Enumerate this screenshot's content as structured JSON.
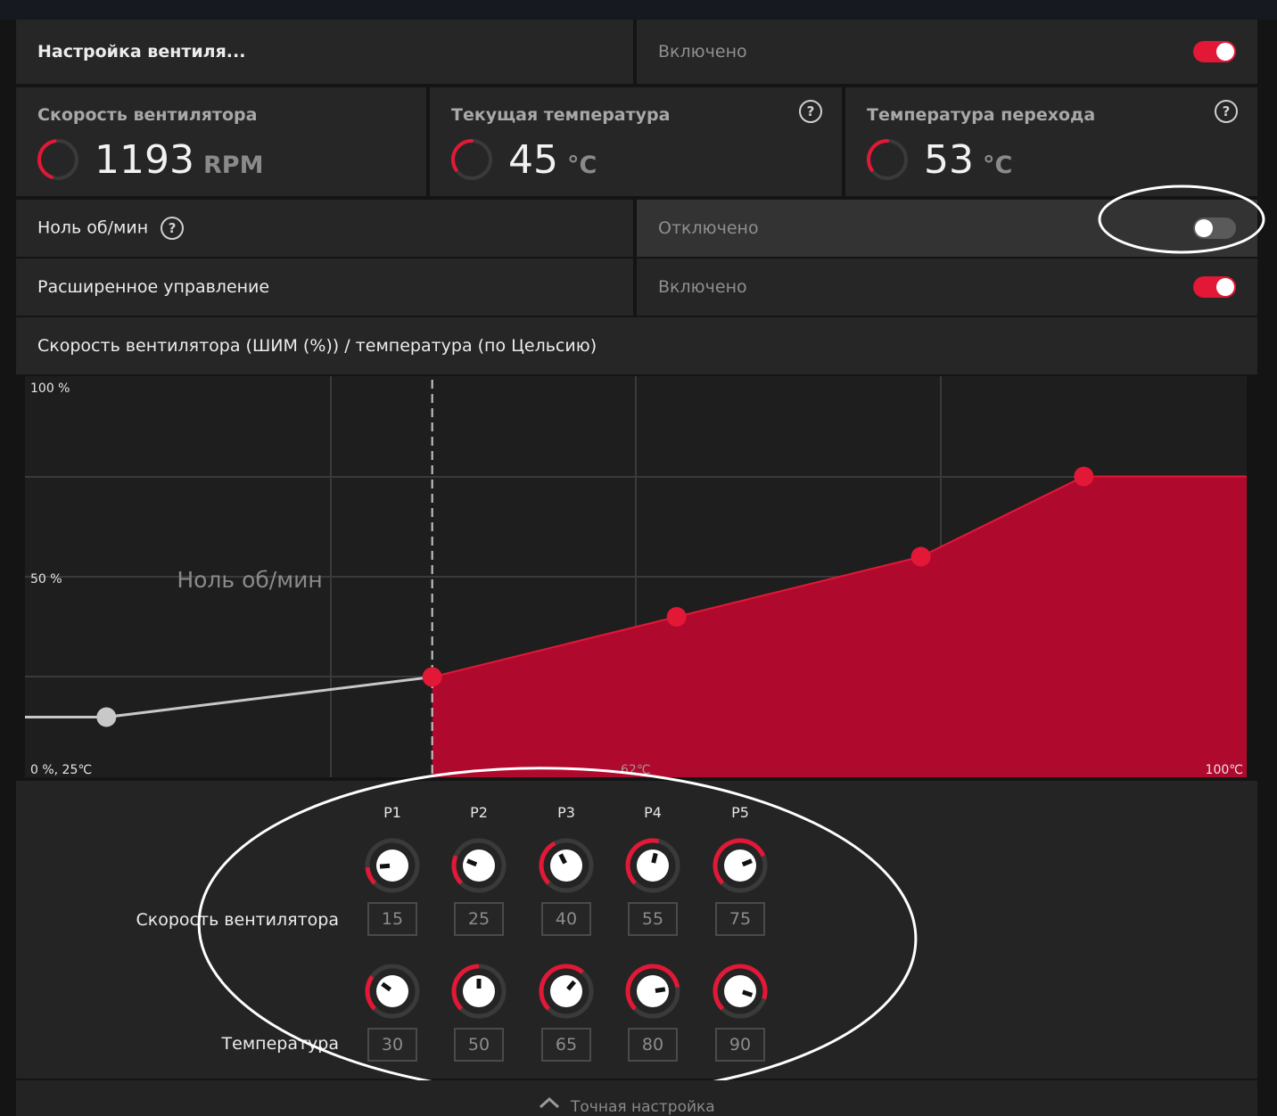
{
  "header": {
    "title": "Настройка вентиля...",
    "status": "Включено",
    "enabled": true
  },
  "stats": [
    {
      "title": "Скорость вентилятора",
      "value": "1193",
      "unit": "RPM"
    },
    {
      "title": "Текущая температура",
      "value": "45",
      "unit": "°C"
    },
    {
      "title": "Температура перехода",
      "value": "53",
      "unit": "°C"
    }
  ],
  "zero_rpm": {
    "label": "Ноль об/мин",
    "status": "Отключено",
    "enabled": false
  },
  "advanced": {
    "label": "Расширенное управление",
    "status": "Включено",
    "enabled": true
  },
  "chart_title": "Скорость вентилятора (ШИМ (%)) / температура (по Цельсию)",
  "chart_labels": {
    "y_top": "100 %",
    "y_mid": "50 %",
    "origin": "0 %, 25℃",
    "x_mid": "62℃",
    "x_max": "100℃",
    "zero_zone": "Ноль об/мин"
  },
  "chart_data": {
    "type": "area",
    "x_range": [
      25,
      100
    ],
    "y_range": [
      0,
      100
    ],
    "inactive_points": [
      {
        "x": 30,
        "y": 15
      },
      {
        "x": 50,
        "y": 25
      }
    ],
    "series": [
      {
        "name": "",
        "points": [
          {
            "x": 50,
            "y": 25
          },
          {
            "x": 65,
            "y": 40
          },
          {
            "x": 80,
            "y": 55
          },
          {
            "x": 90,
            "y": 75
          }
        ]
      }
    ],
    "zero_rpm_threshold": 50,
    "colors": {
      "active": "#e31837",
      "fill": "#b0092e",
      "inactive": "#c8c8c8"
    }
  },
  "points": {
    "headers": [
      "P1",
      "P2",
      "P3",
      "P4",
      "P5"
    ],
    "speed_label": "Скорость вентилятора",
    "temp_label": "Температура",
    "speed": [
      "15",
      "25",
      "40",
      "55",
      "75"
    ],
    "temp": [
      "30",
      "50",
      "65",
      "80",
      "90"
    ]
  },
  "footer": {
    "label": "Точная настройка"
  },
  "colors": {
    "accent": "#e31837"
  }
}
